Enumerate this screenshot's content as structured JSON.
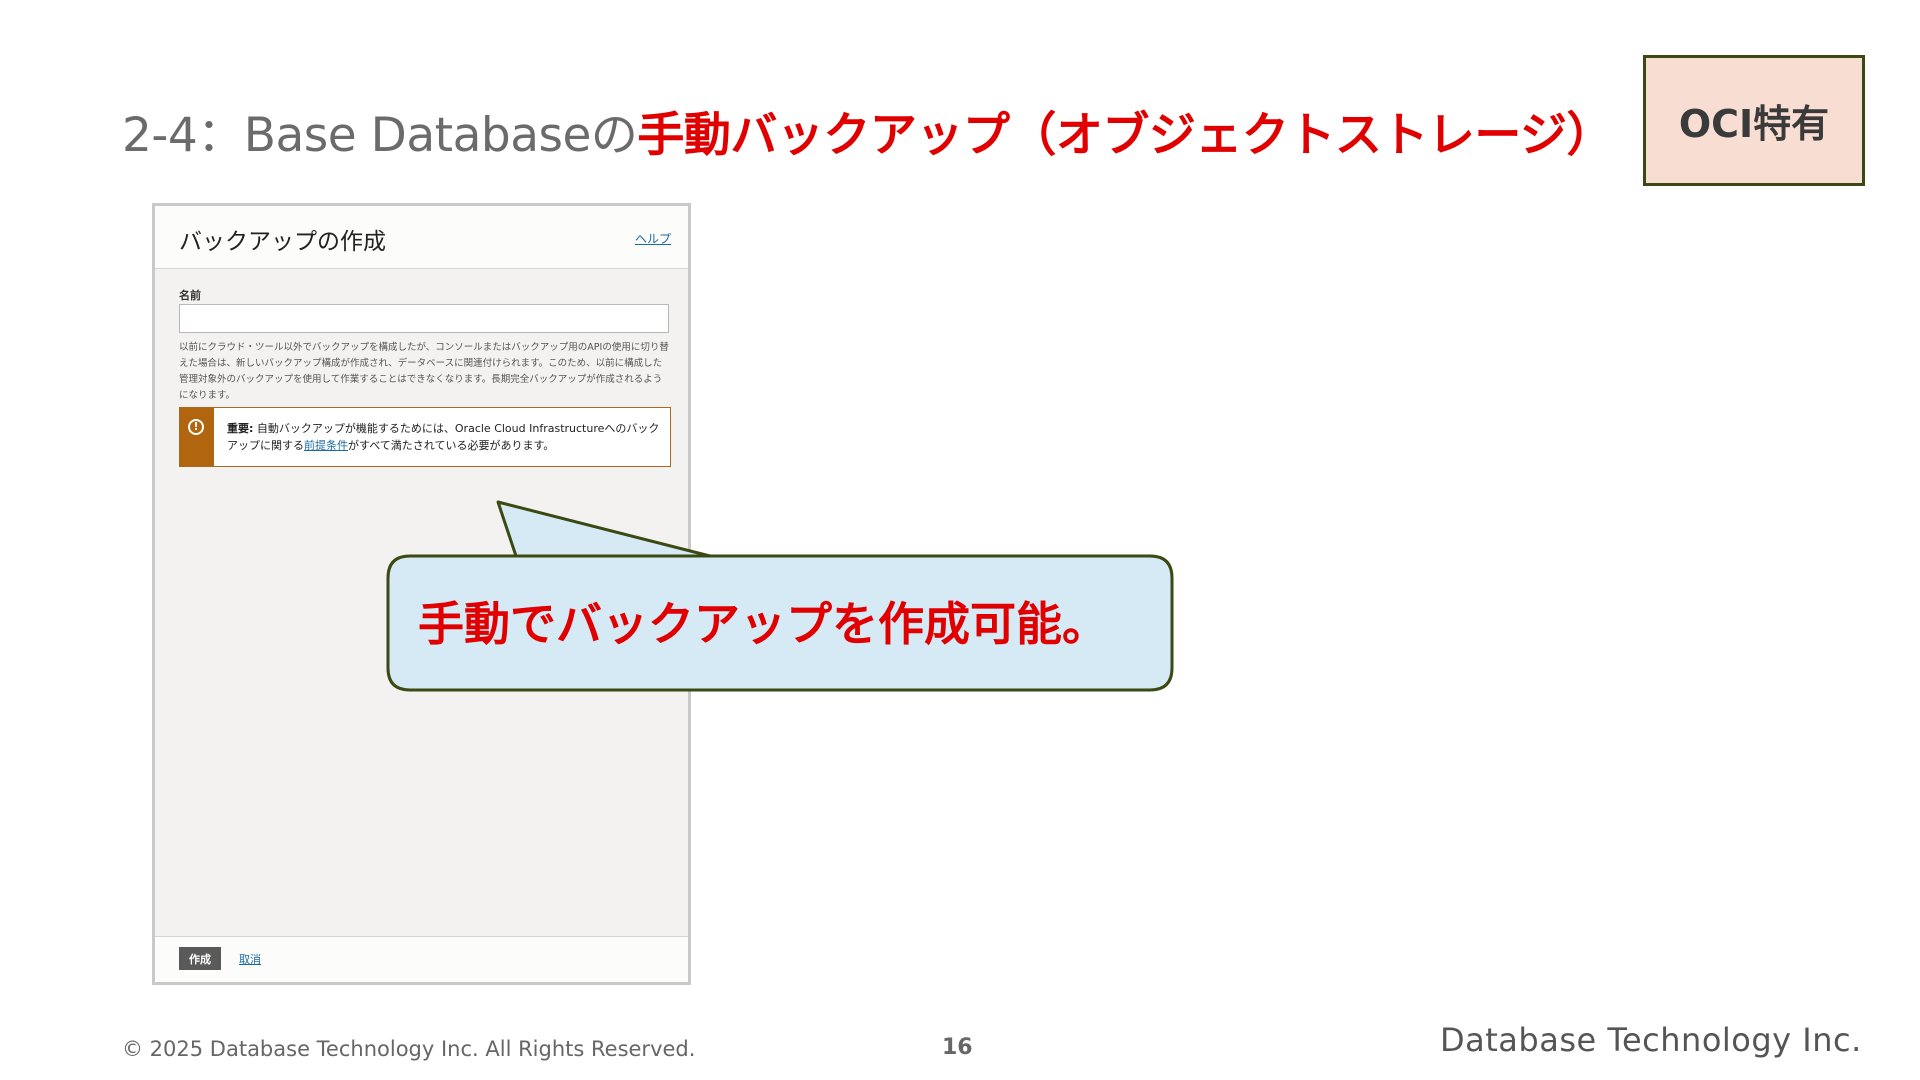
{
  "slide": {
    "title_prefix": "2-4：Base Databaseの",
    "title_highlight": "手動バックアップ（オブジェクトストレージ）",
    "badge": "OCI特有"
  },
  "dialog": {
    "title": "バックアップの作成",
    "help_link": "ヘルプ",
    "name_label": "名前",
    "name_value": "",
    "info_text": "以前にクラウド・ツール以外でバックアップを構成したが、コンソールまたはバックアップ用のAPIの使用に切り替えた場合は、新しいバックアップ構成が作成され、データベースに関連付けられます。このため、以前に構成した管理対象外のバックアップを使用して作業することはできなくなります。長期完全バックアップが作成されるようになります。",
    "alert": {
      "strong": "重要:",
      "text_before": " 自動バックアップが機能するためには、Oracle Cloud Infrastructureへのバックアップに関する",
      "link": "前提条件",
      "text_after": "がすべて満たされている必要があります。"
    },
    "create_button": "作成",
    "cancel_link": "取消"
  },
  "callout": {
    "text": "手動でバックアップを作成可能。"
  },
  "footer": {
    "copyright": "© 2025 Database Technology Inc. All Rights Reserved.",
    "page_number": "16",
    "company": "Database Technology Inc."
  },
  "colors": {
    "highlight": "#e00000",
    "badge_bg": "#f7ddd2",
    "badge_border": "#3a4a12",
    "callout_bg": "#d6eaf6",
    "callout_border": "#3a4a12",
    "alert_accent": "#b0650e",
    "link": "#1a6aa7"
  }
}
